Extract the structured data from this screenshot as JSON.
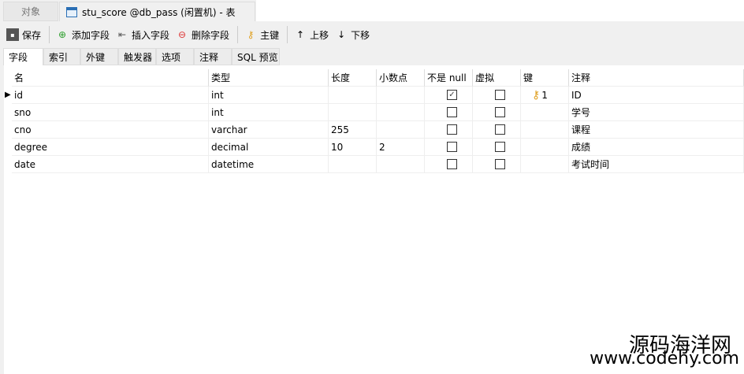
{
  "tabs": {
    "objects": "对象",
    "active": "stu_score @db_pass (闲置机) - 表"
  },
  "toolbar": {
    "save": "保存",
    "add_field": "添加字段",
    "insert_field": "插入字段",
    "delete_field": "删除字段",
    "primary_key": "主键",
    "move_up": "上移",
    "move_down": "下移"
  },
  "subtabs": [
    "字段",
    "索引",
    "外键",
    "触发器",
    "选项",
    "注释",
    "SQL 预览"
  ],
  "columns": [
    "名",
    "类型",
    "长度",
    "小数点",
    "不是 null",
    "虚拟",
    "键",
    "注释"
  ],
  "rows": [
    {
      "name": "id",
      "type": "int",
      "length": "",
      "decimals": "",
      "not_null": true,
      "virtual": false,
      "key": "1",
      "comment": "ID"
    },
    {
      "name": "sno",
      "type": "int",
      "length": "",
      "decimals": "",
      "not_null": false,
      "virtual": false,
      "key": "",
      "comment": "学号"
    },
    {
      "name": "cno",
      "type": "varchar",
      "length": "255",
      "decimals": "",
      "not_null": false,
      "virtual": false,
      "key": "",
      "comment": "课程"
    },
    {
      "name": "degree",
      "type": "decimal",
      "length": "10",
      "decimals": "2",
      "not_null": false,
      "virtual": false,
      "key": "",
      "comment": "成绩"
    },
    {
      "name": "date",
      "type": "datetime",
      "length": "",
      "decimals": "",
      "not_null": false,
      "virtual": false,
      "key": "",
      "comment": "考试时间"
    }
  ],
  "watermark": {
    "title": "源码海洋网",
    "url": "www.codehy.com"
  }
}
